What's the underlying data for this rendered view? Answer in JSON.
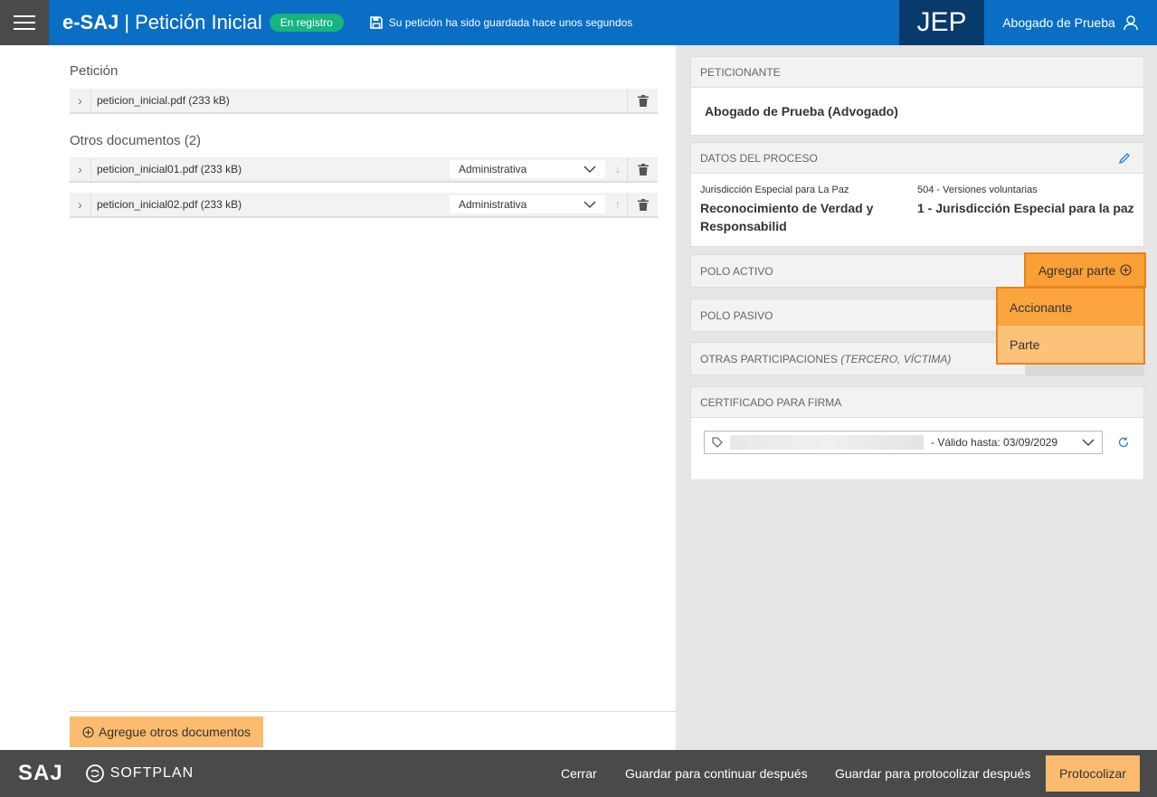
{
  "header": {
    "app_name": "e-SAJ",
    "separator": "|",
    "page_title": "Petición Inicial",
    "status_badge": "En registro",
    "saved_message": "Su petición ha sido guardada hace unos segundos",
    "court": "JEP",
    "user_name": "Abogado de Prueba"
  },
  "left": {
    "peticion_title": "Petición",
    "peticion_file": "peticion_inicial.pdf (233 kB)",
    "otros_title": "Otros documentos (2)",
    "otros_files": [
      {
        "name": "peticion_inicial01.pdf (233 kB)",
        "type": "Administrativa",
        "move": "↓"
      },
      {
        "name": "peticion_inicial02.pdf (233 kB)",
        "type": "Administrativa",
        "move": "↑"
      }
    ],
    "add_docs_label": "Agregue otros documentos"
  },
  "right": {
    "peticionante": {
      "header": "PETICIONANTE",
      "value": "Abogado de Prueba (Advogado)"
    },
    "proceso": {
      "header": "DATOS DEL PROCESO",
      "col1_small": "Jurisdicción Especial para La Paz",
      "col1_big": "Reconocimiento de Verdad y Responsabilid",
      "col2_small": "504 - Versiones voluntarias",
      "col2_big": "1 - Jurisdicción Especial para la paz"
    },
    "polo_activo": "POLO ACTIVO",
    "polo_pasivo": "POLO PASIVO",
    "otras_prefix": "OTRAS PARTICIPACIONES",
    "otras_suffix": "(TERCERO, VÍCTIMA)",
    "agregar_parte": "Agregar parte",
    "dropdown_items": [
      "Accionante",
      "Parte"
    ],
    "certificado": {
      "header": "CERTIFICADO PARA FIRMA",
      "valid_text": "- Válido hasta: 03/09/2029"
    }
  },
  "footer": {
    "logo_saj": "SAJ",
    "logo_softplan": "SOFTPLAN",
    "cerrar": "Cerrar",
    "guardar_continuar": "Guardar para continuar después",
    "guardar_protocolizar": "Guardar para protocolizar después",
    "protocolizar": "Protocolizar"
  },
  "colors": {
    "header_blue": "#0a6ec4",
    "badge_green": "#17b47e",
    "accent_orange": "#f99f35",
    "footer_gray": "#4a4a4a"
  }
}
